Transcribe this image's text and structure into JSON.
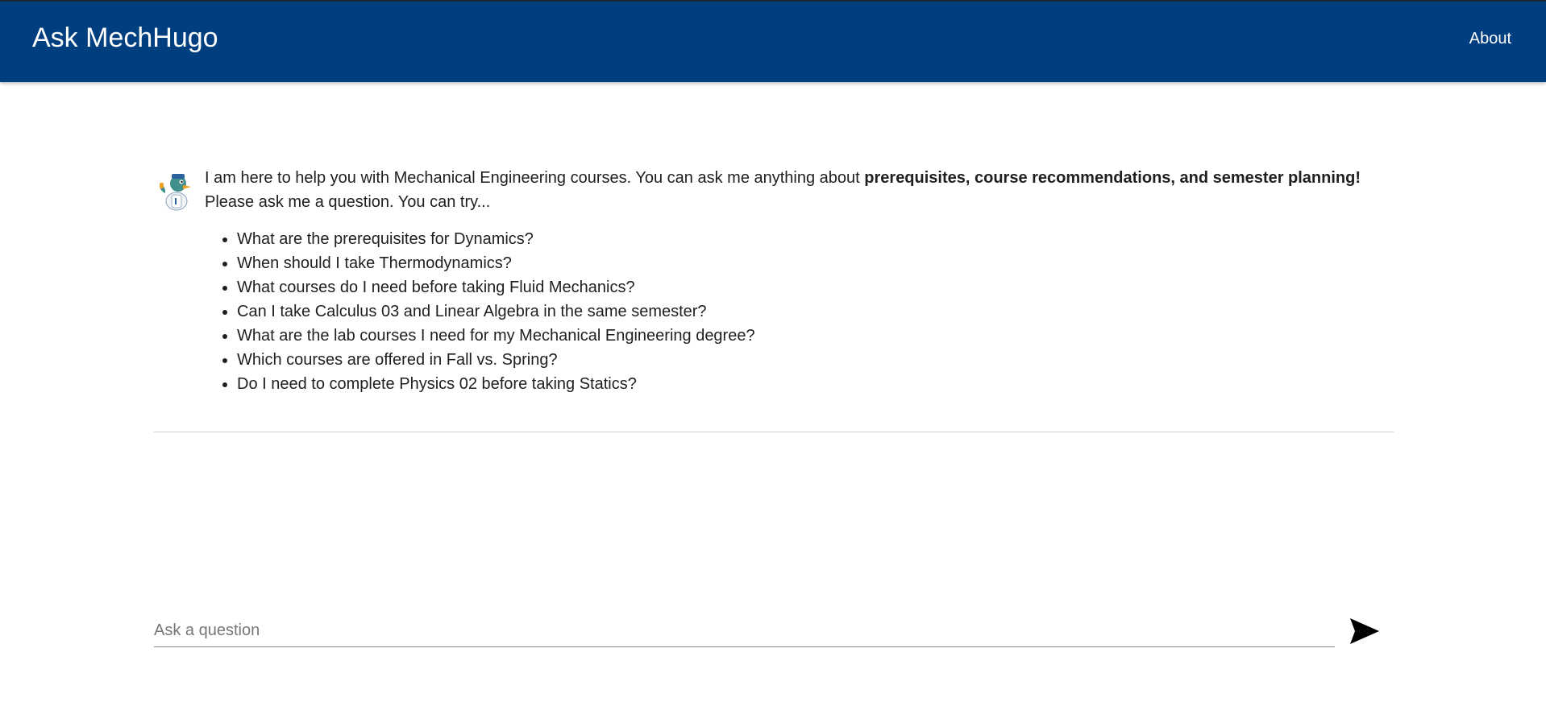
{
  "header": {
    "title": "Ask MechHugo",
    "about_label": "About",
    "bar_color": "#003f7f"
  },
  "chat": {
    "avatar_icon": "mascot-avatar-icon",
    "message": {
      "intro": "I am here to help you with Mechanical Engineering courses. You can ask me anything about ",
      "bold": "prerequisites, course recommendations, and semester planning!",
      "outro": " Please ask me a question. You can try..."
    },
    "suggestions": [
      "What are the prerequisites for Dynamics?",
      "When should I take Thermodynamics?",
      "What courses do I need before taking Fluid Mechanics?",
      "Can I take Calculus 03 and Linear Algebra in the same semester?",
      "What are the lab courses I need for my Mechanical Engineering degree?",
      "Which courses are offered in Fall vs. Spring?",
      "Do I need to complete Physics 02 before taking Statics?"
    ]
  },
  "input": {
    "value": "",
    "placeholder": "Ask a question",
    "send_icon": "send-icon"
  }
}
